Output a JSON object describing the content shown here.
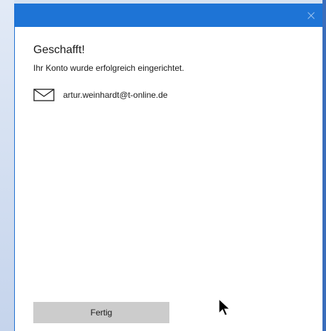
{
  "dialog": {
    "close_icon": "close-icon",
    "heading": "Geschafft!",
    "subtitle": "Ihr Konto wurde erfolgreich eingerichtet.",
    "account": {
      "icon": "mail-icon",
      "email": "artur.weinhardt@t-online.de"
    },
    "done_label": "Fertig"
  },
  "colors": {
    "titlebar": "#1e74d6",
    "button_bg": "#cccccc",
    "window_bg": "#ffffff"
  }
}
